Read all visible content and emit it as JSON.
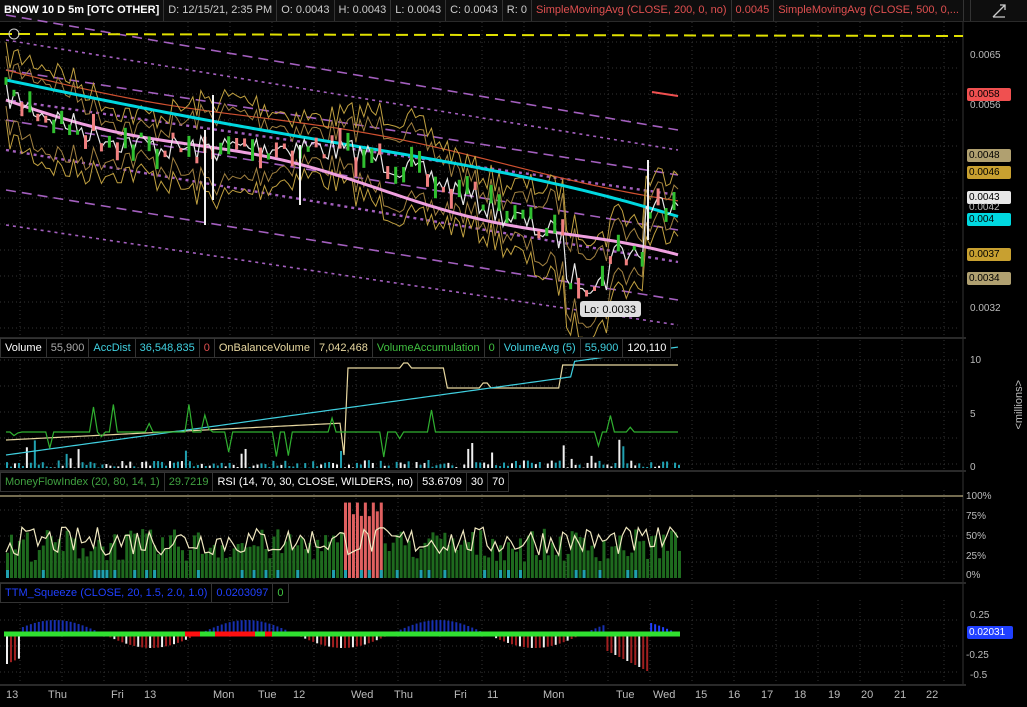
{
  "header": {
    "symbol": "BNOW 10 D 5m [OTC OTHER]",
    "date": "D: 12/15/21, 2:35 PM",
    "open": "O: 0.0043",
    "high": "H: 0.0043",
    "low": "L: 0.0043",
    "close": "C: 0.0043",
    "range": "R: 0",
    "sma200": "SimpleMovingAvg (CLOSE, 200, 0, no)",
    "sma200_value": "0.0045",
    "sma500": "SimpleMovingAvg (CLOSE, 500, 0,..."
  },
  "price_axis": {
    "ticks": [
      "0.0065",
      "0.0056",
      "0.0032"
    ],
    "badges": [
      {
        "label": "0.0058",
        "color": "#f05050",
        "value": 0.0058
      },
      {
        "label": "0.0048",
        "color": "#b0a070",
        "value": 0.0048
      },
      {
        "label": "0.0046",
        "color": "#c8a030",
        "value": 0.0046
      },
      {
        "label": "0.0043",
        "color": "#e8e8e8",
        "value": 0.0043
      },
      {
        "label": "0.0042",
        "color": "#bbbbbb",
        "value": 0.0042
      },
      {
        "label": "0.004",
        "color": "#00d8e0",
        "value": 0.004
      },
      {
        "label": "0.0037",
        "color": "#c8a030",
        "value": 0.0037
      },
      {
        "label": "0.0034",
        "color": "#b0a070",
        "value": 0.0034
      }
    ],
    "low_label": "Lo: 0.0033"
  },
  "volume_panel": {
    "cells": [
      {
        "text": "Volume",
        "color": "#ffffff"
      },
      {
        "text": "55,900",
        "color": "#aaaaaa"
      },
      {
        "text": "AccDist",
        "color": "#40d0e0"
      },
      {
        "text": "36,548,835",
        "color": "#40d0e0"
      },
      {
        "text": "0",
        "color": "#e05050"
      },
      {
        "text": "OnBalanceVolume",
        "color": "#e8d8a0"
      },
      {
        "text": "7,042,468",
        "color": "#e8d8a0"
      },
      {
        "text": "VolumeAccumulation",
        "color": "#40c040"
      },
      {
        "text": "0",
        "color": "#40c040"
      },
      {
        "text": "VolumeAvg (5)",
        "color": "#40d0e0"
      },
      {
        "text": "55,900",
        "color": "#40d0e0"
      },
      {
        "text": "120,110",
        "color": "#ffffff"
      }
    ],
    "ticks": [
      "10",
      "5",
      "0"
    ],
    "unit_label": "<millions>"
  },
  "oscillator_panel": {
    "cells": [
      {
        "text": "MoneyFlowIndex (20, 80, 14, 1)",
        "color": "#40a040"
      },
      {
        "text": "29.7219",
        "color": "#40a040"
      },
      {
        "text": "RSI (14, 70, 30, CLOSE, WILDERS, no)",
        "color": "#ffffff"
      },
      {
        "text": "53.6709",
        "color": "#ffffff"
      },
      {
        "text": "30",
        "color": "#ffffff"
      },
      {
        "text": "70",
        "color": "#ffffff"
      }
    ],
    "ticks": [
      "100%",
      "75%",
      "50%",
      "25%",
      "0%"
    ]
  },
  "squeeze_panel": {
    "cells": [
      {
        "text": "TTM_Squeeze (CLOSE, 20, 1.5, 2.0, 1.0)",
        "color": "#2040ff"
      },
      {
        "text": "0.0203097",
        "color": "#2040ff"
      },
      {
        "text": "0",
        "color": "#40c040"
      }
    ],
    "ticks": [
      "0.25",
      "-0.25",
      "-0.5"
    ],
    "badge": "0.02031"
  },
  "time_axis": {
    "labels": [
      "13",
      "Thu",
      "Fri",
      "13",
      "Mon",
      "Tue",
      "12",
      "Wed",
      "Thu",
      "Fri",
      "11",
      "Mon",
      "Tue",
      "Wed",
      "15",
      "16",
      "17",
      "18",
      "19",
      "20",
      "21",
      "22"
    ]
  },
  "colors": {
    "background": "#000000",
    "candle_up": "#30c030",
    "candle_down": "#f08080",
    "cyan_ma": "#00d8e0",
    "pink_ma": "#f0a0e0",
    "yellow_line": "#e0e000",
    "regression": "#c070e0"
  }
}
